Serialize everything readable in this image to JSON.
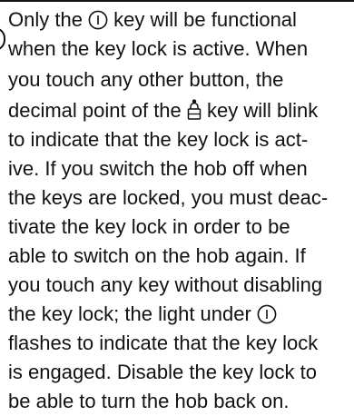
{
  "paragraph": {
    "lines": [
      {
        "pre": "Only the ",
        "icon": "power-icon",
        "post": " key will be functional"
      },
      {
        "text": "when the key lock is active. When"
      },
      {
        "text": "you touch any other button, the"
      },
      {
        "pre": "decimal point of the ",
        "icon": "lock-key-icon",
        "post": " key will blink"
      },
      {
        "text": "to indicate that the key lock is act-"
      },
      {
        "text": "ive. If you switch the hob off when"
      },
      {
        "text": "the keys are locked, you must deac-"
      },
      {
        "text": "tivate the key lock in order to be"
      },
      {
        "text": "able to switch on the hob again. If"
      },
      {
        "text": "you touch any key without disabling"
      },
      {
        "pre": "the key lock; the light under ",
        "icon": "power-icon",
        "post": ""
      },
      {
        "text": "flashes to indicate that the key lock"
      },
      {
        "text": "is engaged. Disable the key lock to"
      },
      {
        "text": "be able to turn the hob back on."
      }
    ]
  }
}
